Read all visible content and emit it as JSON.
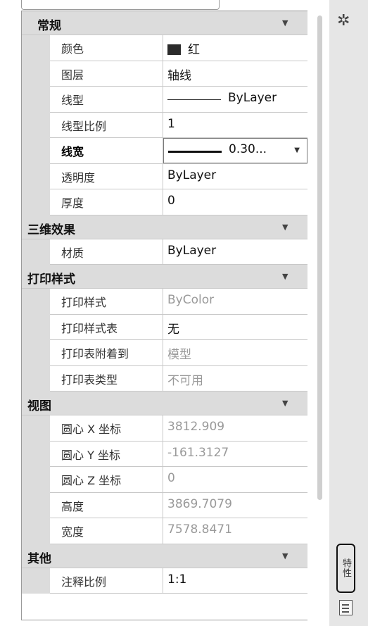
{
  "sections": [
    {
      "title": "常规",
      "rows": [
        {
          "name": "颜色",
          "value": "红"
        },
        {
          "name": "图层",
          "value": "轴线"
        },
        {
          "name": "线型",
          "value": "ByLayer"
        },
        {
          "name": "线型比例",
          "value": "1"
        },
        {
          "name": "线宽",
          "value": "0.30..."
        },
        {
          "name": "透明度",
          "value": "ByLayer"
        },
        {
          "name": "厚度",
          "value": "0"
        }
      ]
    },
    {
      "title": "三维效果",
      "rows": [
        {
          "name": "材质",
          "value": "ByLayer"
        }
      ]
    },
    {
      "title": "打印样式",
      "rows": [
        {
          "name": "打印样式",
          "value": "ByColor"
        },
        {
          "name": "打印样式表",
          "value": "无"
        },
        {
          "name": "打印表附着到",
          "value": "模型"
        },
        {
          "name": "打印表类型",
          "value": "不可用"
        }
      ]
    },
    {
      "title": "视图",
      "rows": [
        {
          "name": "圆心 X 坐标",
          "value": "3812.909"
        },
        {
          "name": "圆心 Y 坐标",
          "value": "-161.3127"
        },
        {
          "name": "圆心 Z 坐标",
          "value": "0"
        },
        {
          "name": "高度",
          "value": "3869.7079"
        },
        {
          "name": "宽度",
          "value": "7578.8471"
        }
      ]
    },
    {
      "title": "其他",
      "rows": [
        {
          "name": "注释比例",
          "value": "1:1"
        }
      ]
    }
  ],
  "colors": {
    "swatch": "#2b2b2b",
    "section_bg": "#dcdcdc",
    "readonly_text": "#9a9a9a"
  },
  "icons": {
    "options": "gear-icon",
    "collapse": "chevron-down-icon",
    "properties_tab": "properties-tab-icon",
    "list": "list-icon"
  },
  "strip": {
    "properties_tab_label": "特性"
  }
}
